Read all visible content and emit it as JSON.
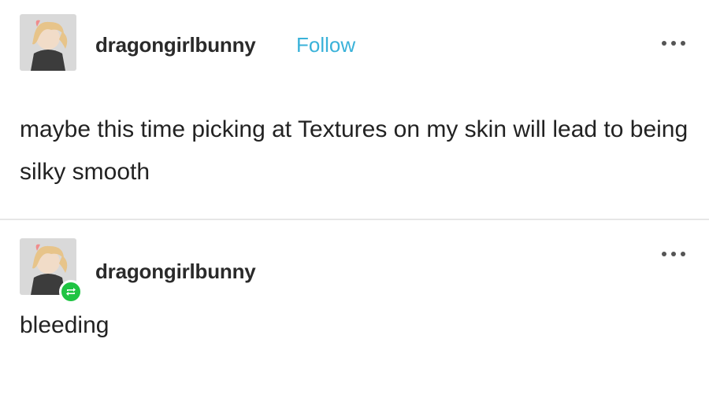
{
  "post": {
    "username": "dragongirlbunny",
    "follow_label": "Follow",
    "more_icon": "ellipsis-icon",
    "body": "maybe this time picking at Textures on my skin will lead to being silky smooth"
  },
  "reblog": {
    "username": "dragongirlbunny",
    "badge_icon": "reblog-icon",
    "more_icon": "ellipsis-icon",
    "body": "bleeding"
  },
  "colors": {
    "follow": "#3ab2d9",
    "reblog_badge": "#1fc443",
    "divider": "#e6e6e6"
  }
}
